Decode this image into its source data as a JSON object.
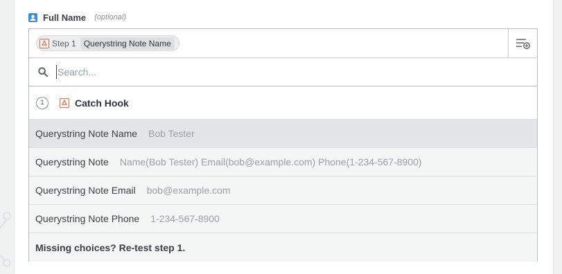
{
  "field": {
    "label": "Full Name",
    "optional": "(optional)"
  },
  "chip": {
    "step": "Step 1",
    "field": "Querystring Note Name"
  },
  "search": {
    "placeholder": "Search...",
    "value": ""
  },
  "step_group": {
    "number": "1",
    "title": "Catch Hook"
  },
  "options": [
    {
      "name": "Querystring Note Name",
      "value": "Bob Tester"
    },
    {
      "name": "Querystring Note",
      "value": "Name(Bob Tester) Email(bob@example.com) Phone(1-234-567-8900)"
    },
    {
      "name": "Querystring Note Email",
      "value": "bob@example.com"
    },
    {
      "name": "Querystring Note Phone",
      "value": "1-234-567-8900"
    }
  ],
  "footer": {
    "text": "Missing choices? Re-test step 1."
  },
  "colors": {
    "accent_blue": "#3b8fd8",
    "zap_orange": "#e8623f",
    "highlight_row": "#e3e6e8"
  }
}
